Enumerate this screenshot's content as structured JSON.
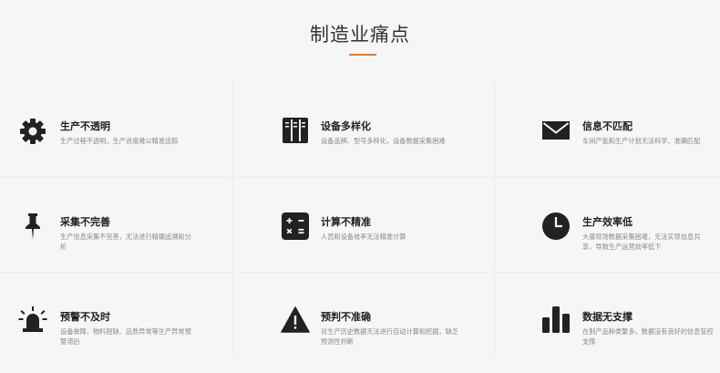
{
  "section": {
    "title": "制造业痛点"
  },
  "items": [
    {
      "icon": "gear-icon",
      "title": "生产不透明",
      "desc": "生产过程不透明，生产进度难以精准追踪"
    },
    {
      "icon": "server-rack-icon",
      "title": "设备多样化",
      "desc": "设备品牌、型号多样化，设备数据采集困难"
    },
    {
      "icon": "envelope-icon",
      "title": "信息不匹配",
      "desc": "车间产能和生产计划无法科学、准确匹配"
    },
    {
      "icon": "pushpin-icon",
      "title": "采集不完善",
      "desc": "生产信息采集不完善，无法进行精确追溯和分析"
    },
    {
      "icon": "calculator-icon",
      "title": "计算不精准",
      "desc": "人员和设备效率无法精准计算"
    },
    {
      "icon": "clock-icon",
      "title": "生产效率低",
      "desc": "大量现场数据采集困难，无法实现信息共享，导致生产运营效率低下"
    },
    {
      "icon": "alarm-light-icon",
      "title": "预警不及时",
      "desc": "设备故障、物料短缺、品质异常等生产异常预警滞后"
    },
    {
      "icon": "warning-icon",
      "title": "预判不准确",
      "desc": "对生产历史数据无法进行自动计算和挖掘，缺乏预测性判断"
    },
    {
      "icon": "bar-chart-icon",
      "title": "数据无支撑",
      "desc": "在制产品种类繁多，数据没有良好的信息管控支撑"
    }
  ]
}
